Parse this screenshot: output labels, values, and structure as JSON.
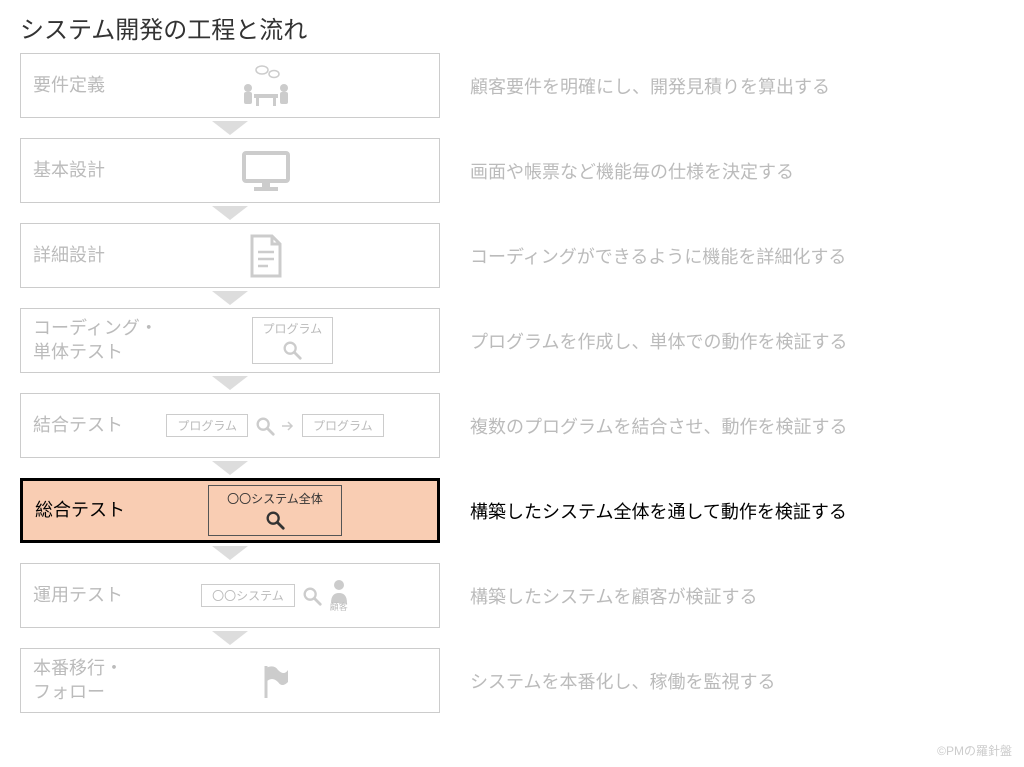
{
  "title": "システム開発の工程と流れ",
  "stages": [
    {
      "name": "要件定義",
      "desc": "顧客要件を明確にし、開発見積りを算出する",
      "icon": "meeting",
      "highlight": false
    },
    {
      "name": "基本設計",
      "desc": "画面や帳票など機能毎の仕様を決定する",
      "icon": "monitor",
      "highlight": false
    },
    {
      "name": "詳細設計",
      "desc": "コーディングができるように機能を詳細化する",
      "icon": "document",
      "highlight": false
    },
    {
      "name": "コーディング・\n単体テスト",
      "desc": "プログラムを作成し、単体での動作を検証する",
      "icon": "program-single",
      "mini_label": "プログラム",
      "highlight": false
    },
    {
      "name": "結合テスト",
      "desc": "複数のプログラムを結合させ、動作を検証する",
      "icon": "program-multi",
      "mini_label": "プログラム",
      "highlight": false
    },
    {
      "name": "総合テスト",
      "desc": "構築したシステム全体を通して動作を検証する",
      "icon": "system-all",
      "mini_label": "〇〇システム全体",
      "highlight": true
    },
    {
      "name": "運用テスト",
      "desc": "構築したシステムを顧客が検証する",
      "icon": "system-customer",
      "mini_label": "〇〇システム",
      "customer_label": "顧客",
      "highlight": false
    },
    {
      "name": "本番移行・\nフォロー",
      "desc": "システムを本番化し、稼働を監視する",
      "icon": "flag",
      "highlight": false
    }
  ],
  "credit": "©PMの羅針盤"
}
